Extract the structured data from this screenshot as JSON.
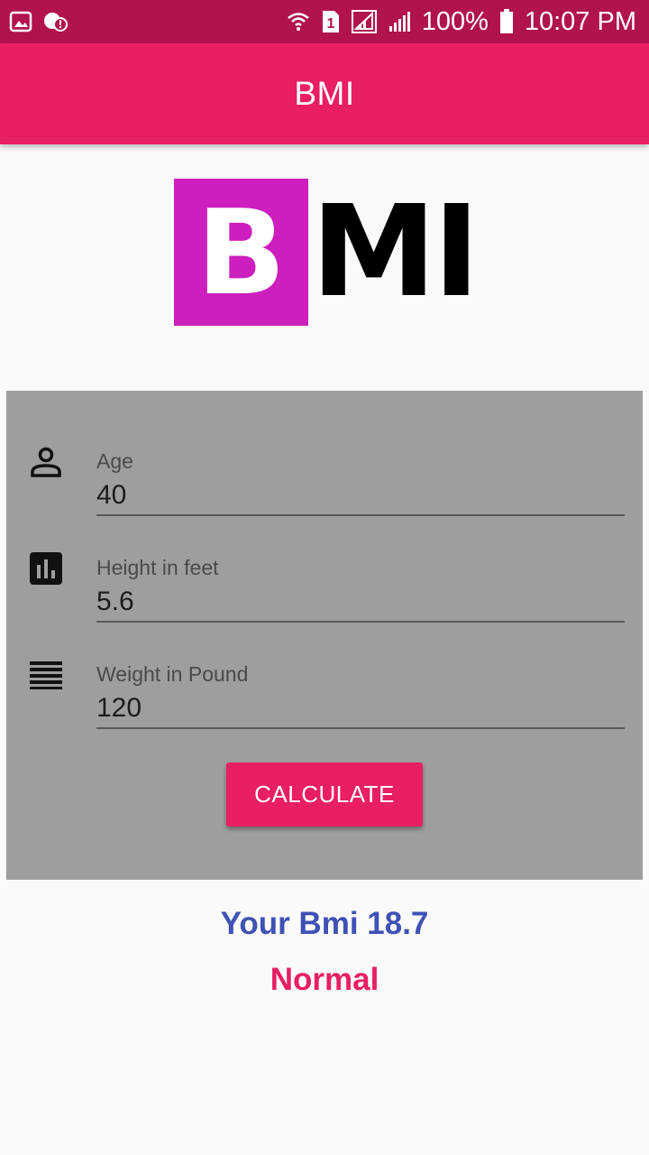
{
  "status_bar": {
    "battery": "100%",
    "time": "10:07 PM",
    "sim_slot": "1"
  },
  "appbar": {
    "title": "BMI"
  },
  "logo": {
    "letter_b": "B",
    "letters_mi": "MI"
  },
  "form": {
    "fields": [
      {
        "label": "Age",
        "value": "40",
        "icon": "person-icon"
      },
      {
        "label": "Height in feet",
        "value": "5.6",
        "icon": "bar-chart-icon"
      },
      {
        "label": "Weight in Pound",
        "value": "120",
        "icon": "weight-lines-icon"
      }
    ],
    "calculate_label": "CALCULATE"
  },
  "result": {
    "bmi_text": "Your Bmi 18.7",
    "category": "Normal"
  },
  "colors": {
    "primary": "#e91e63",
    "status_bar": "#b0134e",
    "panel": "#9e9e9e",
    "bmi_text": "#3f51b5",
    "logo_b": "#cc1fbd"
  }
}
